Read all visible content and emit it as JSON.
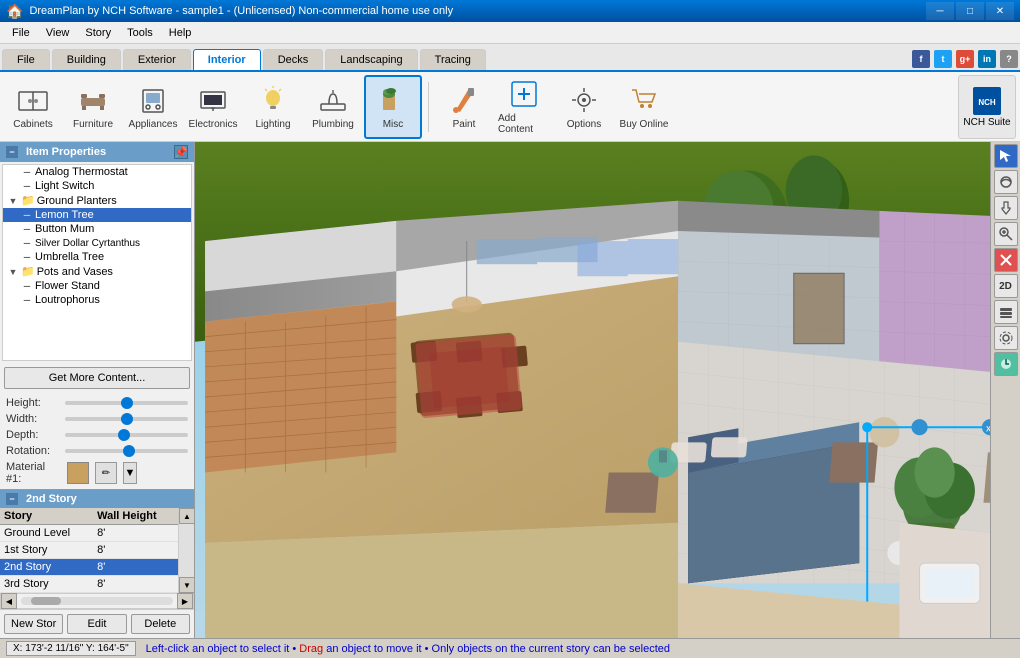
{
  "titlebar": {
    "title": "DreamPlan by NCH Software - sample1 - (Unlicensed) Non-commercial home use only",
    "icon": "🏠",
    "minimize": "─",
    "maximize": "□",
    "close": "✕"
  },
  "menubar": {
    "items": [
      "File",
      "View",
      "Story",
      "Tools",
      "Help"
    ]
  },
  "tabs": {
    "items": [
      "File",
      "Building",
      "Exterior",
      "Interior",
      "Decks",
      "Landscaping",
      "Tracing"
    ],
    "active": "Interior"
  },
  "toolbar": {
    "items": [
      {
        "id": "cabinets",
        "label": "Cabinets"
      },
      {
        "id": "furniture",
        "label": "Furniture"
      },
      {
        "id": "appliances",
        "label": "Appliances"
      },
      {
        "id": "electronics",
        "label": "Electronics"
      },
      {
        "id": "lighting",
        "label": "Lighting"
      },
      {
        "id": "plumbing",
        "label": "Plumbing"
      },
      {
        "id": "misc",
        "label": "Misc"
      },
      {
        "id": "paint",
        "label": "Paint"
      },
      {
        "id": "add-content",
        "label": "Add Content"
      },
      {
        "id": "options",
        "label": "Options"
      },
      {
        "id": "buy-online",
        "label": "Buy Online"
      }
    ],
    "active": "misc",
    "nch_suite": "NCH Suite"
  },
  "item_properties": {
    "title": "Item Properties",
    "tree": [
      {
        "id": "analog-thermostat",
        "label": "Analog Thermostat",
        "indent": 1,
        "type": "leaf"
      },
      {
        "id": "light-switch",
        "label": "Light Switch",
        "indent": 1,
        "type": "leaf"
      },
      {
        "id": "ground-planters",
        "label": "Ground Planters",
        "indent": 0,
        "type": "group",
        "expanded": true
      },
      {
        "id": "lemon-tree",
        "label": "Lemon Tree",
        "indent": 1,
        "type": "leaf",
        "selected": true
      },
      {
        "id": "button-mum",
        "label": "Button Mum",
        "indent": 1,
        "type": "leaf"
      },
      {
        "id": "silver-dollar",
        "label": "Silver Dollar Cyrtanthus",
        "indent": 1,
        "type": "leaf"
      },
      {
        "id": "umbrella-tree",
        "label": "Umbrella Tree",
        "indent": 1,
        "type": "leaf"
      },
      {
        "id": "pots-and-vases",
        "label": "Pots and Vases",
        "indent": 0,
        "type": "group",
        "expanded": true
      },
      {
        "id": "flower-stand",
        "label": "Flower Stand",
        "indent": 1,
        "type": "leaf"
      },
      {
        "id": "loutrophorus",
        "label": "Loutrophorus",
        "indent": 1,
        "type": "leaf"
      }
    ],
    "get_more_btn": "Get More Content...",
    "height_label": "Height:",
    "width_label": "Width:",
    "depth_label": "Depth:",
    "rotation_label": "Rotation:",
    "material_label": "Material #1:"
  },
  "story_panel": {
    "title": "2nd Story",
    "columns": [
      "Story",
      "Wall Height"
    ],
    "rows": [
      {
        "story": "Ground Level",
        "height": "8'",
        "selected": false
      },
      {
        "story": "1st Story",
        "height": "8'",
        "selected": false
      },
      {
        "story": "2nd Story",
        "height": "8'",
        "selected": true
      },
      {
        "story": "3rd Story",
        "height": "8'",
        "selected": false
      }
    ],
    "new_btn": "New Stor",
    "edit_btn": "Edit",
    "delete_btn": "Delete"
  },
  "statusbar": {
    "coords": "X: 173'-2 11/16\" Y: 164'-5\"",
    "message": "Left-click an object to select it • Drag an object to move it • Only objects on the current story can be selected"
  },
  "right_tools": {
    "items": [
      {
        "id": "cursor",
        "icon": "↖",
        "active": true
      },
      {
        "id": "orbit",
        "icon": "⟲"
      },
      {
        "id": "pan",
        "icon": "✋"
      },
      {
        "id": "zoom-in",
        "icon": "🔍"
      },
      {
        "id": "delete",
        "icon": "✕",
        "red": true
      },
      {
        "id": "2d",
        "label": "2D"
      },
      {
        "id": "layers",
        "icon": "☰"
      },
      {
        "id": "settings",
        "icon": "⚙"
      },
      {
        "id": "color",
        "icon": "🎨",
        "teal": true
      }
    ]
  },
  "social": {
    "icons": [
      {
        "id": "fb",
        "label": "f",
        "color": "#3b5998"
      },
      {
        "id": "tw",
        "label": "t",
        "color": "#1da1f2"
      },
      {
        "id": "gp",
        "label": "g",
        "color": "#dd4b39"
      },
      {
        "id": "li",
        "label": "in",
        "color": "#0077b5"
      },
      {
        "id": "help",
        "label": "?",
        "color": "#888"
      }
    ]
  }
}
